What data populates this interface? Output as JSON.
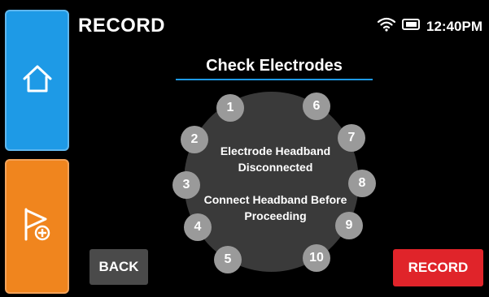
{
  "header": {
    "title": "RECORD",
    "time": "12:40PM"
  },
  "sidebar": {
    "home_icon": "home-icon",
    "flag_icon": "flag-add-icon"
  },
  "status_icons": [
    "wifi-icon",
    "battery-icon"
  ],
  "main": {
    "heading": "Check Electrodes",
    "message_line1": "Electrode Headband",
    "message_line2": "Disconnected",
    "message_line3": "Connect Headband Before",
    "message_line4": "Proceeding",
    "electrodes": [
      "1",
      "2",
      "3",
      "4",
      "5",
      "6",
      "7",
      "8",
      "9",
      "10"
    ]
  },
  "buttons": {
    "back": "BACK",
    "record": "RECORD"
  },
  "colors": {
    "home": "#1e9ae6",
    "flag": "#f0851e",
    "record": "#e0242a",
    "accent": "#1e9ae6"
  }
}
